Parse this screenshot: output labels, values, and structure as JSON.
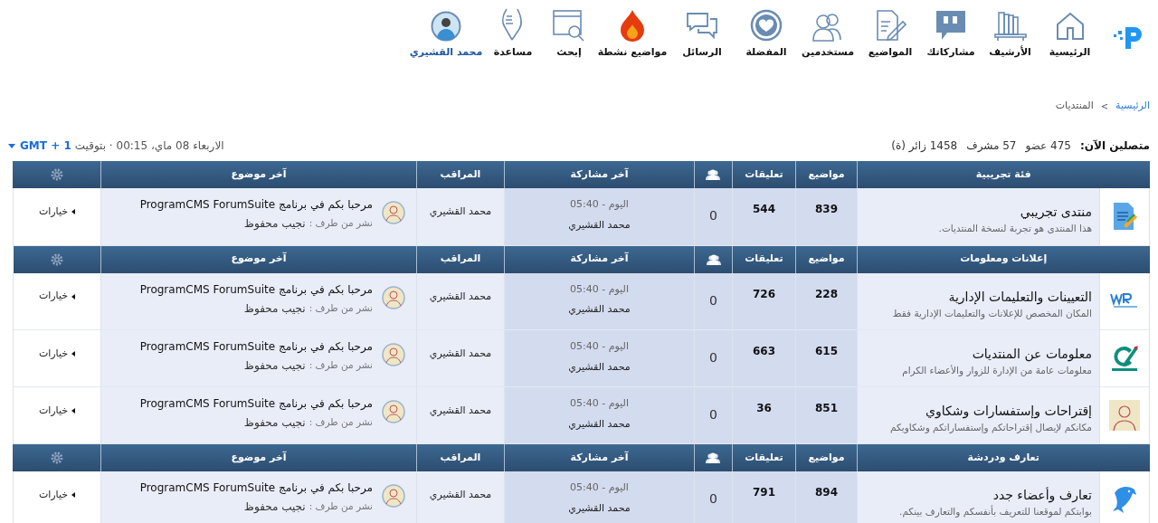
{
  "nav": [
    {
      "label": "الرئيسية",
      "kind": "home"
    },
    {
      "label": "الأرشيف",
      "kind": "archive"
    },
    {
      "label": "مشاركاتك",
      "kind": "posts"
    },
    {
      "label": "المواضيع",
      "kind": "topics"
    },
    {
      "label": "مستخدمين",
      "kind": "users"
    },
    {
      "label": "المفضلة",
      "kind": "favorites"
    },
    {
      "label": "الرسائل",
      "kind": "messages"
    },
    {
      "label": "مواضيع نشطة",
      "kind": "active"
    },
    {
      "label": "إبحث",
      "kind": "search"
    },
    {
      "label": "مساعدة",
      "kind": "help"
    },
    {
      "label": "محمد القشيري",
      "kind": "user"
    }
  ],
  "breadcrumb": {
    "separator": ">",
    "items": [
      {
        "label": "الرئيسية",
        "kind": "link"
      },
      {
        "label": "المنتديات",
        "kind": "current"
      }
    ]
  },
  "online": {
    "label": "متصلين الآن:",
    "items": [
      "475 عضو",
      "57 مشرف",
      "1458 زائر (ة)"
    ]
  },
  "clock": {
    "text": "الاربعاء 08 ماي، 00:15 · بتوقيت",
    "timezone": "GMT + 1"
  },
  "sections": [
    {
      "title": "فئة تجريبية",
      "columns": {
        "topics": "مواضيع",
        "comments": "تعليقات",
        "last_post": "آخر مشاركة",
        "moderator": "المراقب",
        "last_topic": "آخر موضوع"
      },
      "forums": [
        {
          "kind": "document",
          "title": "منتدى تجريبي",
          "description": "هذا المنتدى هو تجربة لنسخة المنتديات.",
          "topics": "839",
          "comments": "544",
          "online": "0",
          "last_post_time": "اليوم - 05:40",
          "last_post_user": "محمد القشيري",
          "moderator": "محمد القشيري",
          "last_topic": "مرحبا بكم في برنامج ProgramCMS ForumSuite",
          "by_label": "نشر من طرف :",
          "author": "نجيب محفوظ",
          "options": "خيارات"
        }
      ]
    },
    {
      "title": "إعلانات ومعلومات",
      "columns": {
        "topics": "مواضيع",
        "comments": "تعليقات",
        "last_post": "آخر مشاركة",
        "moderator": "المراقب",
        "last_topic": "آخر موضوع"
      },
      "forums": [
        {
          "kind": "wave-logo",
          "title": "التعيينات والتعليمات الإدارية",
          "description": "المكان المخصص للإعلانات والتعليمات الإدارية فقط",
          "topics": "228",
          "comments": "726",
          "online": "0",
          "last_post_time": "اليوم - 05:40",
          "last_post_user": "محمد القشيري",
          "moderator": "محمد القشيري",
          "last_topic": "مرحبا بكم في برنامج ProgramCMS ForumSuite",
          "by_label": "نشر من طرف :",
          "author": "نجيب محفوظ",
          "options": "خيارات"
        },
        {
          "kind": "swoosh-logo",
          "title": "معلومات عن المنتديات",
          "description": "معلومات عامة من الإدارة للزوار والأعضاء الكرام",
          "topics": "615",
          "comments": "663",
          "online": "0",
          "last_post_time": "اليوم - 05:40",
          "last_post_user": "محمد القشيري",
          "moderator": "محمد القشيري",
          "last_topic": "مرحبا بكم في برنامج ProgramCMS ForumSuite",
          "by_label": "نشر من طرف :",
          "author": "نجيب محفوظ",
          "options": "خيارات"
        },
        {
          "kind": "portrait",
          "title": "إقتراحات وإستفسارات وشكاوي",
          "description": "مكانكم لإيصال إقتراحاتكم وإستفساراتكم وشكاويكم",
          "topics": "851",
          "comments": "36",
          "online": "0",
          "last_post_time": "اليوم - 05:40",
          "last_post_user": "محمد القشيري",
          "moderator": "محمد القشيري",
          "last_topic": "مرحبا بكم في برنامج ProgramCMS ForumSuite",
          "by_label": "نشر من طرف :",
          "author": "نجيب محفوظ",
          "options": "خيارات"
        }
      ]
    },
    {
      "title": "تعارف ودردشة",
      "columns": {
        "topics": "مواضيع",
        "comments": "تعليقات",
        "last_post": "آخر مشاركة",
        "moderator": "المراقب",
        "last_topic": "آخر موضوع"
      },
      "forums": [
        {
          "kind": "dolphin",
          "title": "تعارف وأعضاء جدد",
          "description": "بوابتكم لموقعنا للتعريف بأنفسكم والتعارف بينكم.",
          "topics": "894",
          "comments": "791",
          "online": "0",
          "last_post_time": "اليوم - 05:40",
          "last_post_user": "محمد القشيري",
          "moderator": "محمد القشيري",
          "last_topic": "مرحبا بكم في برنامج ProgramCMS ForumSuite",
          "by_label": "نشر من طرف :",
          "author": "نجيب محفوظ",
          "options": "خيارات"
        }
      ]
    }
  ]
}
